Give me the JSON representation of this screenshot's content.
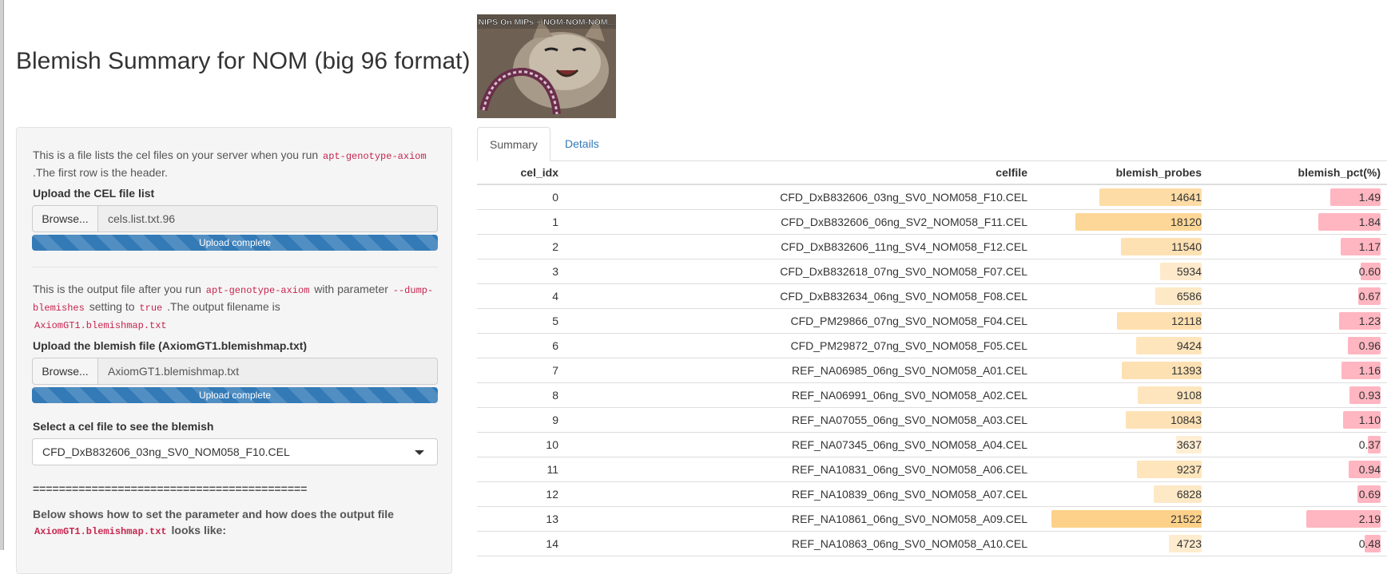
{
  "page": {
    "title": "Blemish Summary for NOM (big 96 format)",
    "meme_caption": "NIPS On MIPs = NOM-NOM-NOM..."
  },
  "sidebar": {
    "desc1_pre": "This is a file lists the cel files on your server when you run",
    "desc1_code": "apt-genotype-axiom",
    "desc1_post": ".The first row is the header.",
    "upload1_label": "Upload the CEL file list",
    "browse_label": "Browse...",
    "upload1_filename": "cels.list.txt.96",
    "upload1_status": "Upload complete",
    "desc2_pre": "This is the output file after you run",
    "desc2_code1": "apt-genotype-axiom",
    "desc2_mid1": "with parameter",
    "desc2_code2": "--dump-blemishes",
    "desc2_mid2": "setting to",
    "desc2_code3": "true",
    "desc2_mid3": ".The output filename is",
    "desc2_code4": "AxiomGT1.blemishmap.txt",
    "upload2_label": "Upload the blemish file (AxiomGT1.blemishmap.txt)",
    "upload2_filename": "AxiomGT1.blemishmap.txt",
    "upload2_status": "Upload complete",
    "select_label": "Select a cel file to see the blemish",
    "select_value": "CFD_DxB832606_03ng_SV0_NOM058_F10.CEL",
    "separator": "==========================================",
    "bottom_pre": "Below shows how to set the parameter and how does the output file",
    "bottom_code": "AxiomGT1.blemishmap.txt",
    "bottom_post": "looks like:"
  },
  "tabs": [
    {
      "label": "Summary",
      "active": true
    },
    {
      "label": "Details",
      "active": false
    }
  ],
  "table": {
    "headers": [
      "cel_idx",
      "celfile",
      "blemish_probes",
      "blemish_pct(%)"
    ],
    "rows": [
      {
        "cel_idx": "0",
        "celfile": "CFD_DxB832606_03ng_SV0_NOM058_F10.CEL",
        "blemish_probes": "14641",
        "blemish_pct": "1.49"
      },
      {
        "cel_idx": "1",
        "celfile": "CFD_DxB832606_06ng_SV2_NOM058_F11.CEL",
        "blemish_probes": "18120",
        "blemish_pct": "1.84"
      },
      {
        "cel_idx": "2",
        "celfile": "CFD_DxB832606_11ng_SV4_NOM058_F12.CEL",
        "blemish_probes": "11540",
        "blemish_pct": "1.17"
      },
      {
        "cel_idx": "3",
        "celfile": "CFD_DxB832618_07ng_SV0_NOM058_F07.CEL",
        "blemish_probes": "5934",
        "blemish_pct": "0.60"
      },
      {
        "cel_idx": "4",
        "celfile": "CFD_DxB832634_06ng_SV0_NOM058_F08.CEL",
        "blemish_probes": "6586",
        "blemish_pct": "0.67"
      },
      {
        "cel_idx": "5",
        "celfile": "CFD_PM29866_07ng_SV0_NOM058_F04.CEL",
        "blemish_probes": "12118",
        "blemish_pct": "1.23"
      },
      {
        "cel_idx": "6",
        "celfile": "CFD_PM29872_07ng_SV0_NOM058_F05.CEL",
        "blemish_probes": "9424",
        "blemish_pct": "0.96"
      },
      {
        "cel_idx": "7",
        "celfile": "REF_NA06985_06ng_SV0_NOM058_A01.CEL",
        "blemish_probes": "11393",
        "blemish_pct": "1.16"
      },
      {
        "cel_idx": "8",
        "celfile": "REF_NA06991_06ng_SV0_NOM058_A02.CEL",
        "blemish_probes": "9108",
        "blemish_pct": "0.93"
      },
      {
        "cel_idx": "9",
        "celfile": "REF_NA07055_06ng_SV0_NOM058_A03.CEL",
        "blemish_probes": "10843",
        "blemish_pct": "1.10"
      },
      {
        "cel_idx": "10",
        "celfile": "REF_NA07345_06ng_SV0_NOM058_A04.CEL",
        "blemish_probes": "3637",
        "blemish_pct": "0.37"
      },
      {
        "cel_idx": "11",
        "celfile": "REF_NA10831_06ng_SV0_NOM058_A06.CEL",
        "blemish_probes": "9237",
        "blemish_pct": "0.94"
      },
      {
        "cel_idx": "12",
        "celfile": "REF_NA10839_06ng_SV0_NOM058_A07.CEL",
        "blemish_probes": "6828",
        "blemish_pct": "0.69"
      },
      {
        "cel_idx": "13",
        "celfile": "REF_NA10861_06ng_SV0_NOM058_A09.CEL",
        "blemish_probes": "21522",
        "blemish_pct": "2.19"
      },
      {
        "cel_idx": "14",
        "celfile": "REF_NA10863_06ng_SV0_NOM058_A10.CEL",
        "blemish_probes": "4723",
        "blemish_pct": "0.48"
      }
    ]
  },
  "colors": {
    "probes_bar_low": "#fff4e3",
    "probes_bar_high": "#fdd189",
    "pct_bar": "#ffb6c1",
    "link": "#337ab7",
    "progress": "#337ab7"
  }
}
